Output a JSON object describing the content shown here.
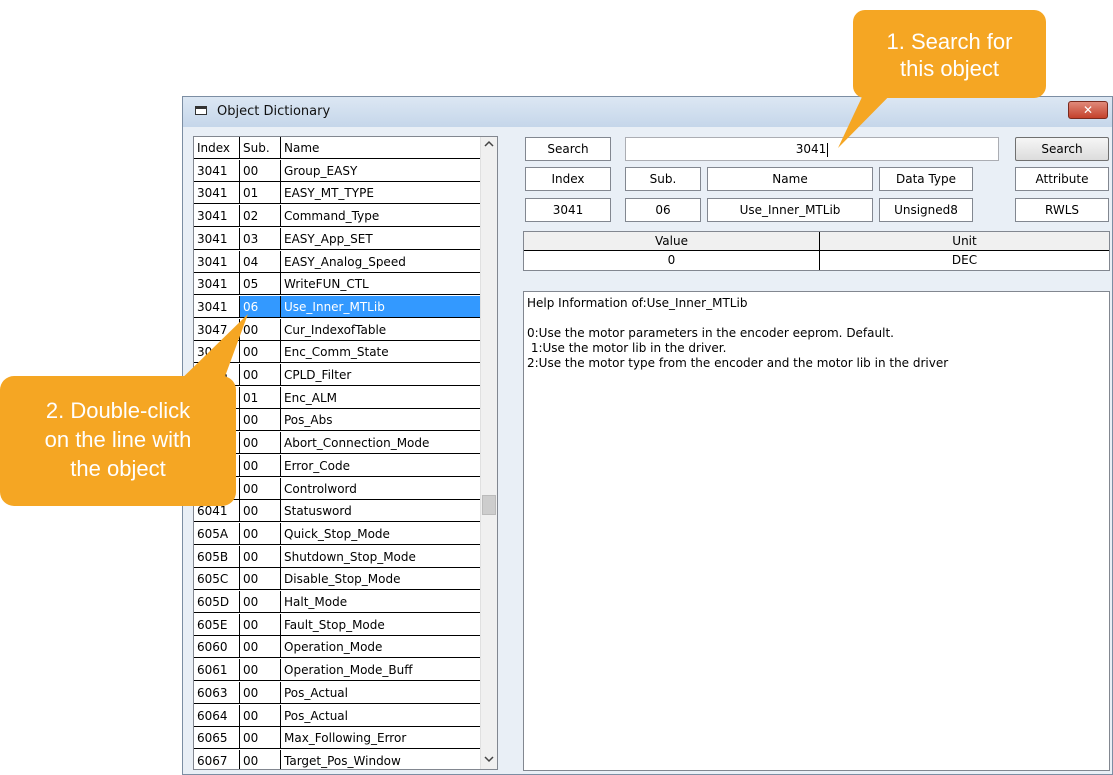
{
  "window": {
    "title": "Object Dictionary",
    "close_label": "✕"
  },
  "list": {
    "headers": {
      "index": "Index",
      "sub": "Sub.",
      "name": "Name"
    },
    "rows": [
      {
        "index": "3041",
        "sub": "00",
        "name": "Group_EASY"
      },
      {
        "index": "3041",
        "sub": "01",
        "name": "EASY_MT_TYPE"
      },
      {
        "index": "3041",
        "sub": "02",
        "name": "Command_Type"
      },
      {
        "index": "3041",
        "sub": "03",
        "name": "EASY_App_SET"
      },
      {
        "index": "3041",
        "sub": "04",
        "name": "EASY_Analog_Speed"
      },
      {
        "index": "3041",
        "sub": "05",
        "name": "WriteFUN_CTL"
      },
      {
        "index": "3041",
        "sub": "06",
        "name": "Use_Inner_MTLib",
        "selected": true
      },
      {
        "index": "3047",
        "sub": "00",
        "name": "Cur_IndexofTable"
      },
      {
        "index": "3045",
        "sub": "00",
        "name": "Enc_Comm_State"
      },
      {
        "index": "3046",
        "sub": "00",
        "name": "CPLD_Filter"
      },
      {
        "index": "",
        "sub": "01",
        "name": "Enc_ALM"
      },
      {
        "index": "",
        "sub": "00",
        "name": "Pos_Abs"
      },
      {
        "index": "",
        "sub": "00",
        "name": "Abort_Connection_Mode"
      },
      {
        "index": "",
        "sub": "00",
        "name": "Error_Code"
      },
      {
        "index": "",
        "sub": "00",
        "name": "Controlword"
      },
      {
        "index": "6041",
        "sub": "00",
        "name": "Statusword"
      },
      {
        "index": "605A",
        "sub": "00",
        "name": "Quick_Stop_Mode"
      },
      {
        "index": "605B",
        "sub": "00",
        "name": "Shutdown_Stop_Mode"
      },
      {
        "index": "605C",
        "sub": "00",
        "name": "Disable_Stop_Mode"
      },
      {
        "index": "605D",
        "sub": "00",
        "name": "Halt_Mode"
      },
      {
        "index": "605E",
        "sub": "00",
        "name": "Fault_Stop_Mode"
      },
      {
        "index": "6060",
        "sub": "00",
        "name": "Operation_Mode"
      },
      {
        "index": "6061",
        "sub": "00",
        "name": "Operation_Mode_Buff"
      },
      {
        "index": "6063",
        "sub": "00",
        "name": "Pos_Actual"
      },
      {
        "index": "6064",
        "sub": "00",
        "name": "Pos_Actual"
      },
      {
        "index": "6065",
        "sub": "00",
        "name": "Max_Following_Error"
      },
      {
        "index": "6067",
        "sub": "00",
        "name": "Target_Pos_Window"
      }
    ]
  },
  "search": {
    "label": "Search",
    "value": "3041",
    "button_label": "Search"
  },
  "info": {
    "headers": {
      "index": "Index",
      "sub": "Sub.",
      "name": "Name",
      "data_type": "Data Type",
      "attribute": "Attribute"
    },
    "values": {
      "index": "3041",
      "sub": "06",
      "name": "Use_Inner_MTLib",
      "data_type": "Unsigned8",
      "attribute": "RWLS"
    }
  },
  "value_unit": {
    "value_header": "Value",
    "unit_header": "Unit",
    "value": "0",
    "unit": "DEC"
  },
  "help": {
    "lines": [
      "Help Information of:Use_Inner_MTLib",
      "",
      "0:Use the motor parameters in the encoder eeprom. Default.",
      " 1:Use the motor lib in the driver.",
      "2:Use the motor type from the encoder and the motor lib in the driver"
    ]
  },
  "callouts": {
    "search": {
      "line1": "1. Search for",
      "line2": "this object"
    },
    "dblclick": {
      "line1": "2. Double-click",
      "line2": "on the line with",
      "line3": "the object"
    }
  },
  "colors": {
    "callout": "#f5a623",
    "selection": "#3399ff"
  },
  "icons": {
    "title": "window-icon",
    "scroll_up": "chevron-up-icon",
    "scroll_down": "chevron-down-icon"
  }
}
